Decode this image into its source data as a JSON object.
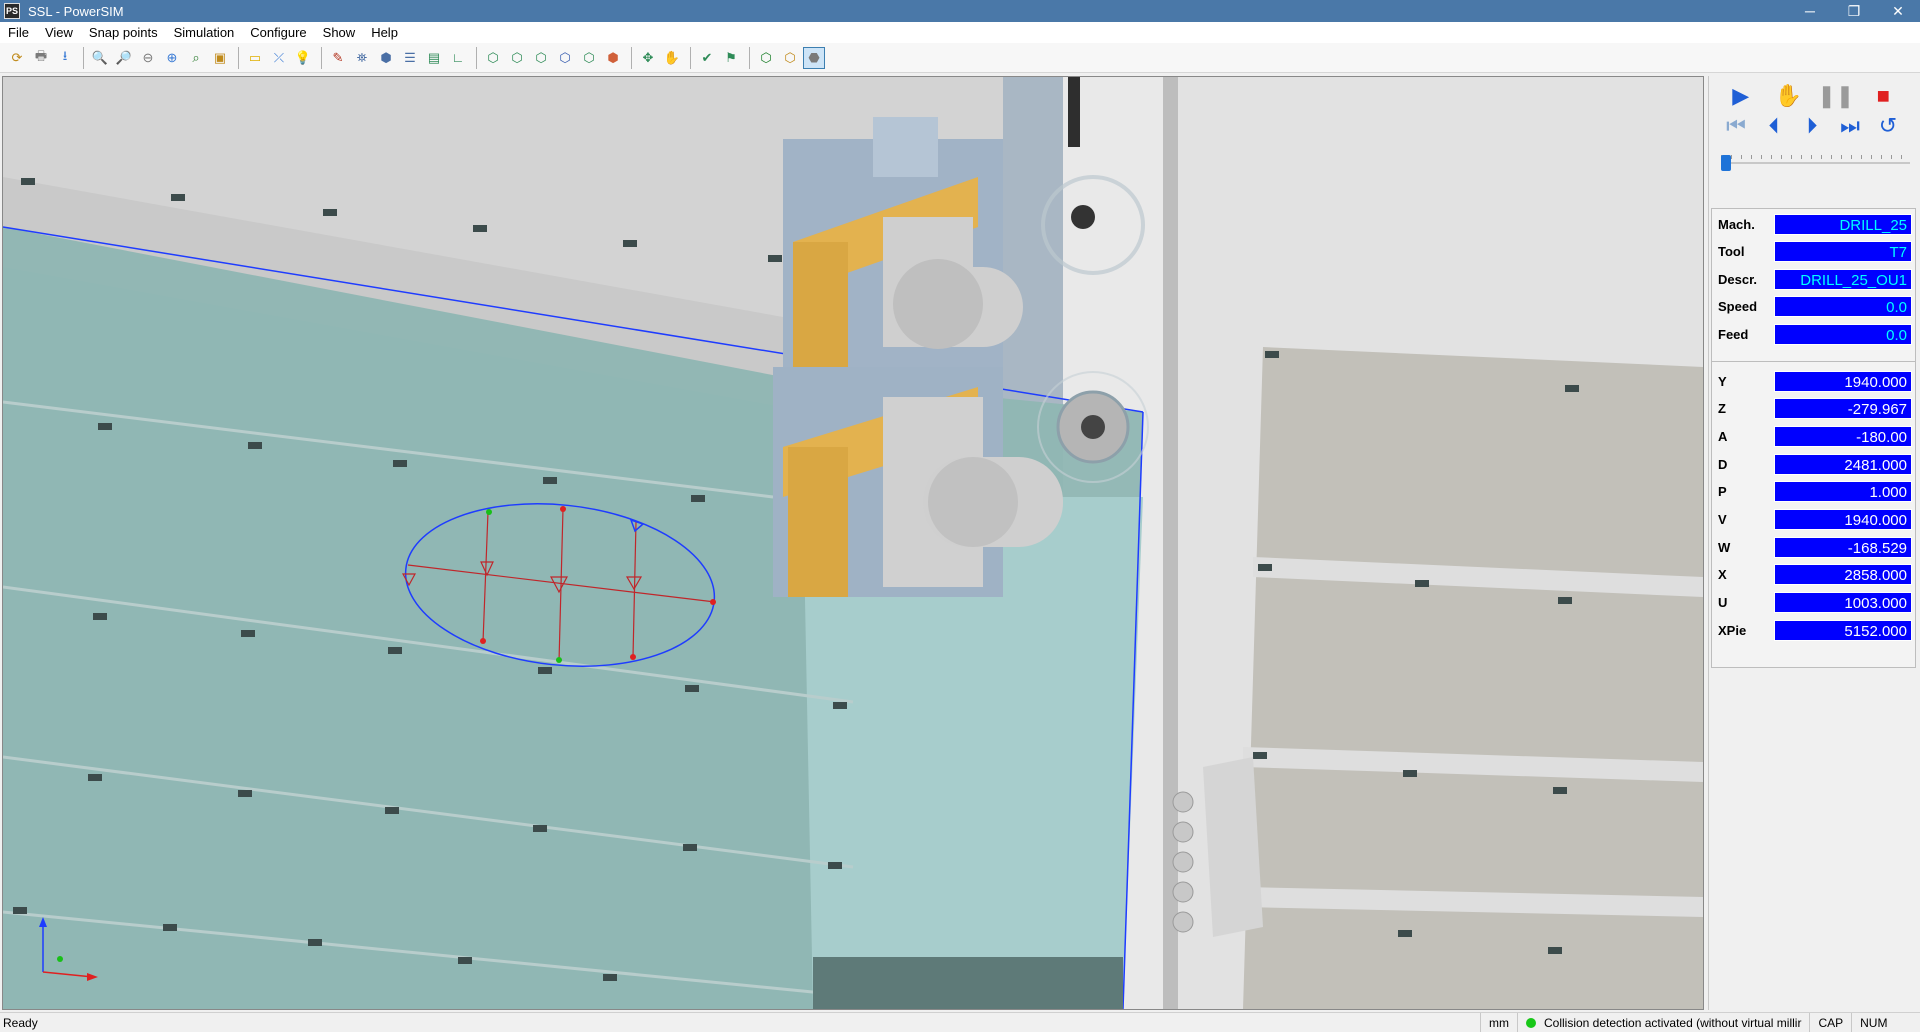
{
  "window": {
    "app_icon": "PS",
    "title": "SSL - PowerSIM",
    "controls": [
      "─",
      "❐",
      "✕"
    ]
  },
  "menu": [
    "File",
    "View",
    "Snap points",
    "Simulation",
    "Configure",
    "Show",
    "Help"
  ],
  "toolbar": {
    "groups": [
      [
        "⟳",
        "🖶",
        "⭳"
      ],
      [
        "🔍",
        "🔎",
        "⊖",
        "⊕",
        "⌕",
        "▣"
      ],
      [
        "▭",
        "⤫",
        "💡"
      ],
      [
        "✎",
        "⛯",
        "⬢",
        "☰",
        "▤",
        "∟"
      ],
      [
        "⬡",
        "⬡",
        "⬡",
        "⬡",
        "⬡",
        "⬢"
      ],
      [
        "✥",
        "✋"
      ],
      [
        "✔",
        "⚑"
      ],
      [
        "⬡",
        "⬡",
        "⬣"
      ]
    ]
  },
  "playback": {
    "row1": [
      {
        "name": "play-icon",
        "glyph": "▶",
        "color": "#1f5fd6"
      },
      {
        "name": "hand-icon",
        "glyph": "✋",
        "color": "#e8b000"
      },
      {
        "name": "pause-icon",
        "glyph": "❚❚",
        "color": "#9a9a9a"
      },
      {
        "name": "stop-icon",
        "glyph": "■",
        "color": "#e02020"
      }
    ],
    "row2": [
      {
        "name": "skip-start-icon",
        "glyph": "⏮",
        "color": "#8aaad0"
      },
      {
        "name": "step-back-icon",
        "glyph": "⏴",
        "color": "#1f5fd6"
      },
      {
        "name": "step-forward-icon",
        "glyph": "⏵",
        "color": "#1f5fd6"
      },
      {
        "name": "skip-end-icon",
        "glyph": "⏭",
        "color": "#1f5fd6"
      },
      {
        "name": "rewind-icon",
        "glyph": "↺",
        "color": "#1f5fd6"
      }
    ],
    "slider_position": 0.0
  },
  "info": [
    {
      "label": "Mach.",
      "value": "DRILL_25",
      "cyan": true
    },
    {
      "label": "Tool",
      "value": "T7",
      "cyan": true
    },
    {
      "label": "Descr.",
      "value": "DRILL_25_OU1",
      "cyan": true
    },
    {
      "label": "Speed",
      "value": "0.0",
      "cyan": true
    },
    {
      "label": "Feed",
      "value": "0.0",
      "cyan": true
    }
  ],
  "axes": [
    {
      "label": "Y",
      "value": "1940.000"
    },
    {
      "label": "Z",
      "value": "-279.967"
    },
    {
      "label": "A",
      "value": "-180.00"
    },
    {
      "label": "D",
      "value": "2481.000"
    },
    {
      "label": "P",
      "value": "1.000"
    },
    {
      "label": "V",
      "value": "1940.000"
    },
    {
      "label": "W",
      "value": "-168.529"
    },
    {
      "label": "X",
      "value": "2858.000"
    },
    {
      "label": "U",
      "value": "1003.000"
    },
    {
      "label": "XPie",
      "value": "5152.000"
    }
  ],
  "status": {
    "ready": "Ready",
    "units": "mm",
    "collision": "Collision detection activated (without virtual millir",
    "cap": "CAP",
    "num": "NUM"
  }
}
